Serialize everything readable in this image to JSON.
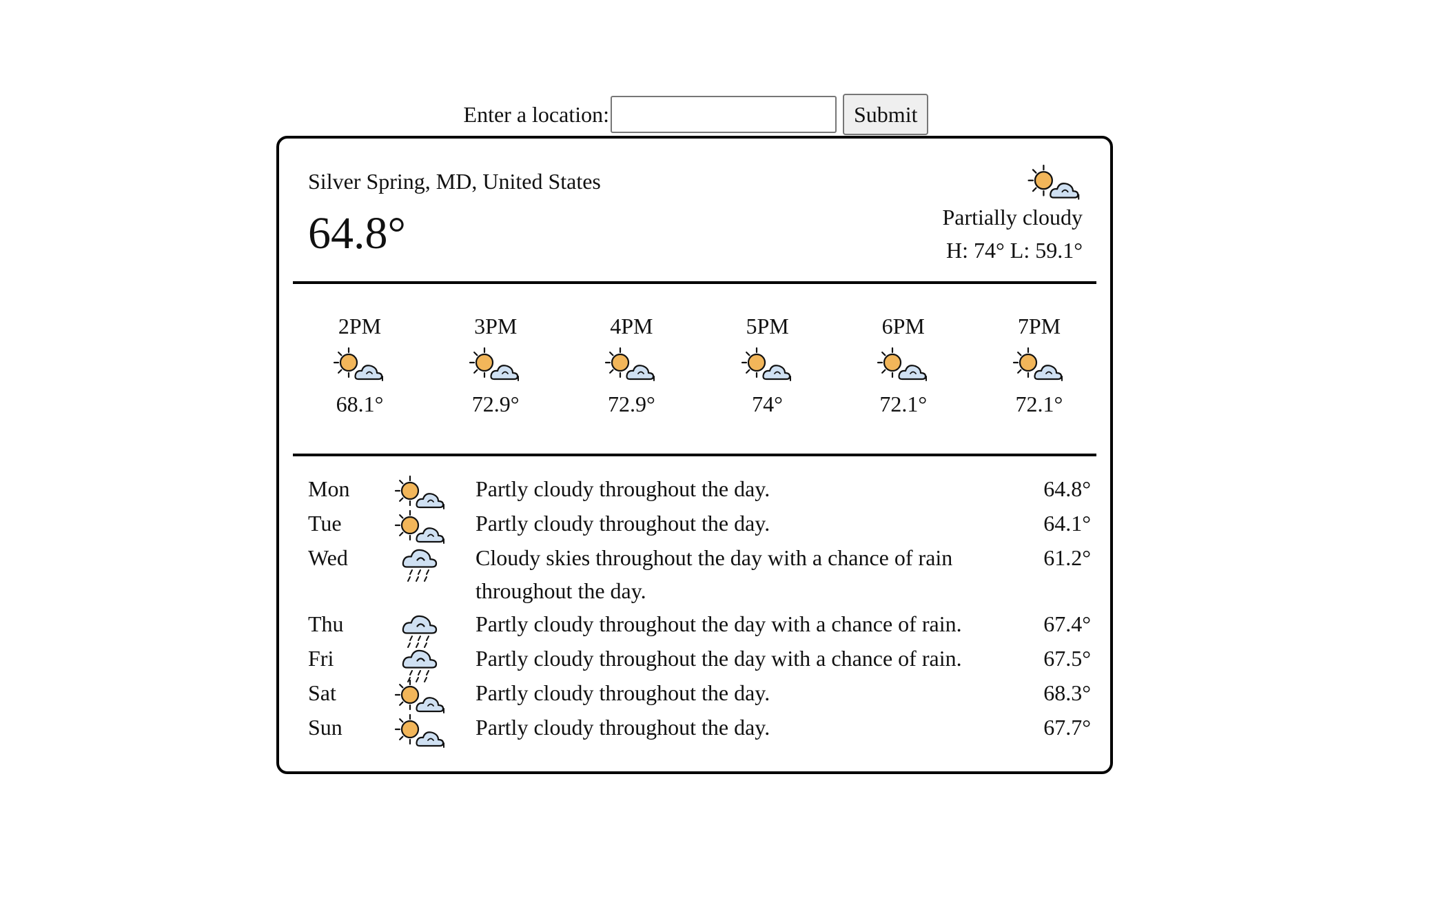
{
  "search": {
    "label": "Enter a location:",
    "value": "",
    "placeholder": "",
    "submit_label": "Submit"
  },
  "current": {
    "location": "Silver Spring, MD, United States",
    "temperature": "64.8°",
    "condition": "Partially cloudy",
    "high": "H: 74°",
    "low": "L: 59.1°",
    "icon": "partly-cloudy-day-icon"
  },
  "hourly": [
    {
      "time": "2PM",
      "temp": "68.1°",
      "icon": "partly-cloudy-day-icon"
    },
    {
      "time": "3PM",
      "temp": "72.9°",
      "icon": "partly-cloudy-day-icon"
    },
    {
      "time": "4PM",
      "temp": "72.9°",
      "icon": "partly-cloudy-day-icon"
    },
    {
      "time": "5PM",
      "temp": "74°",
      "icon": "partly-cloudy-day-icon"
    },
    {
      "time": "6PM",
      "temp": "72.1°",
      "icon": "partly-cloudy-day-icon"
    },
    {
      "time": "7PM",
      "temp": "72.1°",
      "icon": "partly-cloudy-day-icon"
    }
  ],
  "daily": [
    {
      "day": "Mon",
      "desc": "Partly cloudy throughout the day.",
      "temp": "64.8°",
      "icon": "partly-cloudy-day-icon"
    },
    {
      "day": "Tue",
      "desc": "Partly cloudy throughout the day.",
      "temp": "64.1°",
      "icon": "partly-cloudy-day-icon"
    },
    {
      "day": "Wed",
      "desc": "Cloudy skies throughout the day with a chance of rain throughout the day.",
      "temp": "61.2°",
      "icon": "rain-icon"
    },
    {
      "day": "Thu",
      "desc": "Partly cloudy throughout the day with a chance of rain.",
      "temp": "67.4°",
      "icon": "rain-icon"
    },
    {
      "day": "Fri",
      "desc": "Partly cloudy throughout the day with a chance of rain.",
      "temp": "67.5°",
      "icon": "rain-icon"
    },
    {
      "day": "Sat",
      "desc": "Partly cloudy throughout the day.",
      "temp": "68.3°",
      "icon": "partly-cloudy-day-icon"
    },
    {
      "day": "Sun",
      "desc": "Partly cloudy throughout the day.",
      "temp": "67.7°",
      "icon": "partly-cloudy-day-icon"
    }
  ],
  "colors": {
    "sun": "#f2b65a",
    "cloud": "#cfe0f2",
    "outline": "#111111",
    "border": "#000000"
  }
}
